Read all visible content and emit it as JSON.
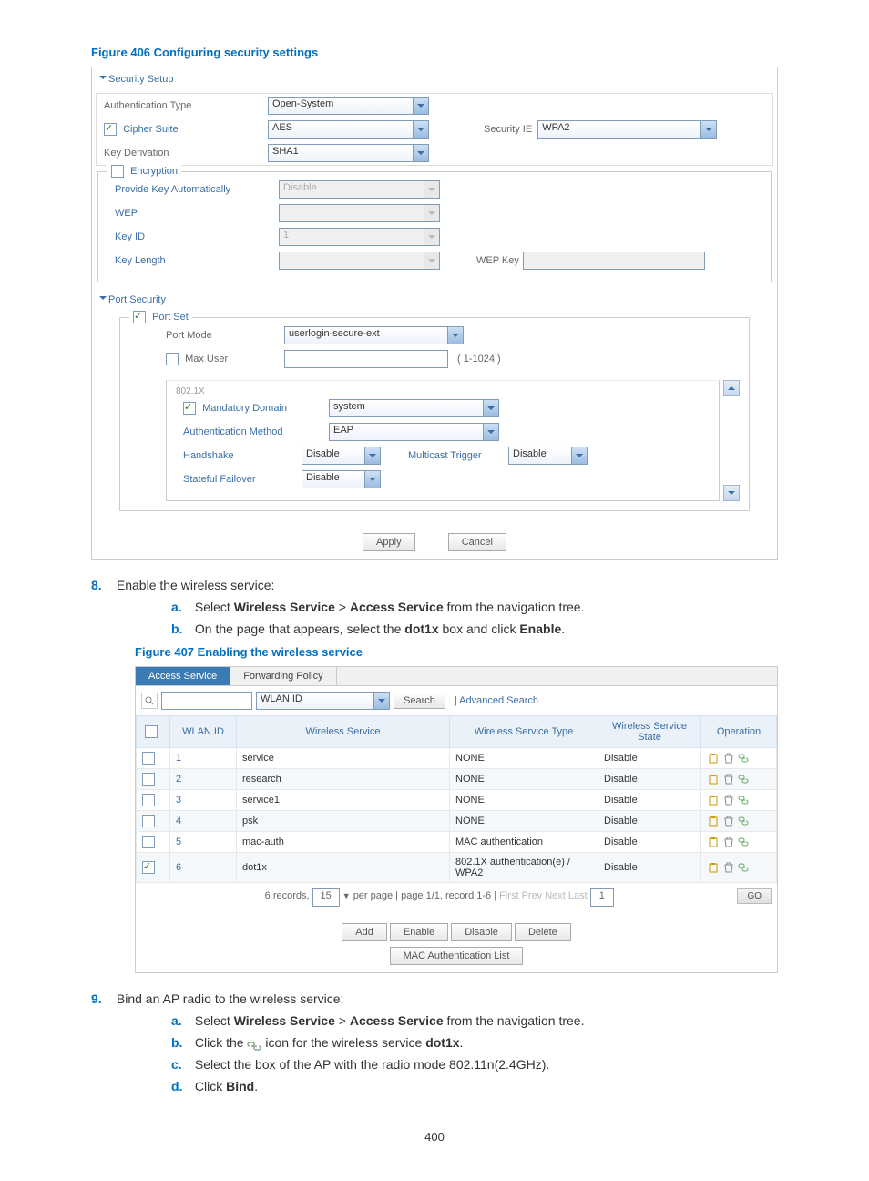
{
  "fig406": {
    "title": "Figure 406 Configuring security settings",
    "security_setup": "Security Setup",
    "auth_type_label": "Authentication Type",
    "auth_type_value": "Open-System",
    "cipher_suite_label": "Cipher Suite",
    "cipher_suite_value": "AES",
    "security_ie_label": "Security IE",
    "security_ie_value": "WPA2",
    "key_deriv_label": "Key Derivation",
    "key_deriv_value": "SHA1",
    "encryption_label": "Encryption",
    "pka_label": "Provide Key Automatically",
    "pka_value": "Disable",
    "wep_label": "WEP",
    "key_id_label": "Key ID",
    "key_id_value": "1",
    "key_length_label": "Key Length",
    "wep_key_label": "WEP Key",
    "port_security": "Port Security",
    "port_set": "Port Set",
    "port_mode_label": "Port Mode",
    "port_mode_value": "userlogin-secure-ext",
    "max_user_label": "Max User",
    "max_user_range": "( 1-1024 )",
    "eight02": "802.1X",
    "mand_domain_label": "Mandatory Domain",
    "mand_domain_value": "system",
    "auth_method_label": "Authentication Method",
    "auth_method_value": "EAP",
    "handshake_label": "Handshake",
    "handshake_value": "Disable",
    "multicast_trigger_label": "Multicast Trigger",
    "multicast_trigger_value": "Disable",
    "stateful_failover_label": "Stateful Failover",
    "stateful_failover_value": "Disable",
    "apply": "Apply",
    "cancel": "Cancel"
  },
  "step8": {
    "num": "8.",
    "text": "Enable the wireless service:",
    "a_letter": "a.",
    "a_pre": "Select ",
    "a_b1": "Wireless Service",
    "a_mid": " > ",
    "a_b2": "Access Service",
    "a_post": " from the navigation tree.",
    "b_letter": "b.",
    "b_pre": "On the page that appears, select the ",
    "b_b1": "dot1x",
    "b_mid": " box and click ",
    "b_b2": "Enable",
    "b_post": "."
  },
  "fig407": {
    "title": "Figure 407 Enabling the wireless service",
    "tab_access": "Access Service",
    "tab_policy": "Forwarding Policy",
    "search_field": "WLAN ID",
    "search_btn": "Search",
    "adv_search": "Advanced Search",
    "cols": {
      "cb": "",
      "wlanid": "WLAN ID",
      "service": "Wireless Service",
      "type": "Wireless Service Type",
      "state": "Wireless Service State",
      "op": "Operation"
    },
    "rows": [
      {
        "id": "1",
        "svc": "service",
        "type": "NONE",
        "state": "Disable",
        "checked": false
      },
      {
        "id": "2",
        "svc": "research",
        "type": "NONE",
        "state": "Disable",
        "checked": false
      },
      {
        "id": "3",
        "svc": "service1",
        "type": "NONE",
        "state": "Disable",
        "checked": false
      },
      {
        "id": "4",
        "svc": "psk",
        "type": "NONE",
        "state": "Disable",
        "checked": false
      },
      {
        "id": "5",
        "svc": "mac-auth",
        "type": "MAC authentication",
        "state": "Disable",
        "checked": false
      },
      {
        "id": "6",
        "svc": "dot1x",
        "type": "802.1X authentication(e) / WPA2",
        "state": "Disable",
        "checked": true
      }
    ],
    "pager_pre": "6 records,",
    "pager_perpage": "15",
    "pager_mid": "per page | page 1/1, record 1-6 |",
    "pager_nav": "First Prev Next Last",
    "pager_page": "1",
    "go": "GO",
    "btn_add": "Add",
    "btn_enable": "Enable",
    "btn_disable": "Disable",
    "btn_delete": "Delete",
    "btn_mac": "MAC Authentication List"
  },
  "step9": {
    "num": "9.",
    "text": "Bind an AP radio to the wireless service:",
    "a_letter": "a.",
    "a_pre": "Select ",
    "a_b1": "Wireless Service",
    "a_mid": " > ",
    "a_b2": "Access Service",
    "a_post": " from the navigation tree.",
    "b_letter": "b.",
    "b_pre": "Click the ",
    "b_mid": " icon for the wireless service ",
    "b_b1": "dot1x",
    "b_post": ".",
    "c_letter": "c.",
    "c_text": "Select the box of the AP with the radio mode 802.11n(2.4GHz).",
    "d_letter": "d.",
    "d_pre": "Click ",
    "d_b1": "Bind",
    "d_post": "."
  },
  "page_number": "400"
}
